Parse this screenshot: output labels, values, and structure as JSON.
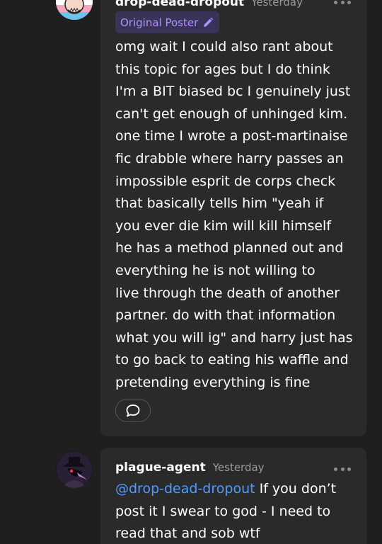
{
  "comments": [
    {
      "username": "drop-dead-dropout",
      "timestamp": "Yesterday",
      "badge": "Original Poster",
      "body": "omg wait I could also rant about\nthis topic for ages but I do think\nI'm a BIT biased bc I genuinely just\ncan't get enough of unhinged kim.\none time I wrote a post-martinaise\nfic drabble where harry passes an\nimpossible esprit de corps check\nthat basically tells him \"yeah if\nyou ever die kim will kill himself\nhe has a method planned out and\neverything he is not willing to\nlive through the death of another\npartner. do with that information\nwhat you will ig\" and harry just has\nto go back to eating his waffle and\npretending everything is fine",
      "avatar_icon": "avatar-cartoon-face-icon",
      "reply_icon": "speech-bubble-icon",
      "more_icon": "ellipsis-icon"
    },
    {
      "username": "plague-agent",
      "timestamp": "Yesterday",
      "mention": "@drop-dead-dropout",
      "body": " If you don’t\npost it I swear to god - I need to\nread that and sob wtf",
      "avatar_icon": "avatar-plague-doctor-icon",
      "more_icon": "ellipsis-icon"
    }
  ],
  "colors": {
    "background": "#1f1f1f",
    "card": "#2a2a2a",
    "op_badge_bg": "#3a3358",
    "op_badge_text": "#b191ff",
    "mention": "#4f9cff",
    "timestamp": "#9a9a9a"
  }
}
